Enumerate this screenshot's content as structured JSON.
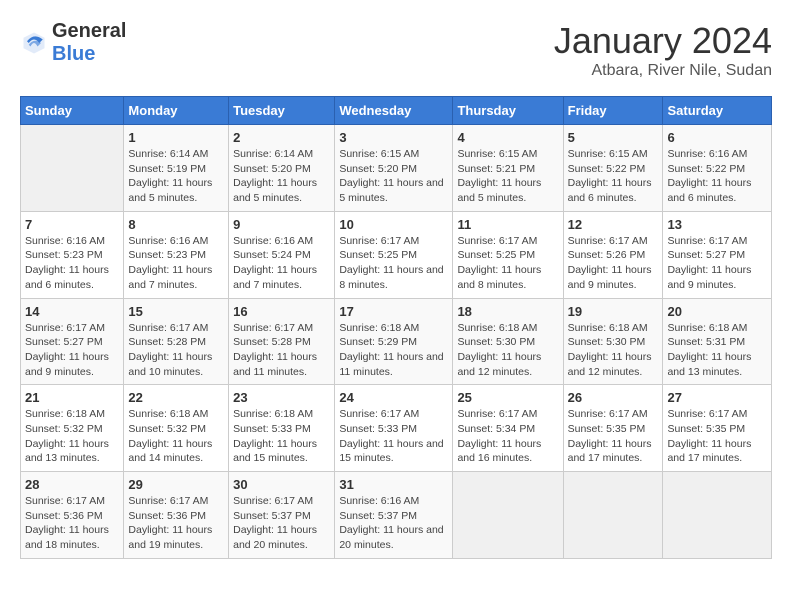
{
  "logo": {
    "text_general": "General",
    "text_blue": "Blue"
  },
  "title": "January 2024",
  "subtitle": "Atbara, River Nile, Sudan",
  "days_of_week": [
    "Sunday",
    "Monday",
    "Tuesday",
    "Wednesday",
    "Thursday",
    "Friday",
    "Saturday"
  ],
  "weeks": [
    [
      {
        "day": "",
        "sunrise": "",
        "sunset": "",
        "daylight": ""
      },
      {
        "day": "1",
        "sunrise": "Sunrise: 6:14 AM",
        "sunset": "Sunset: 5:19 PM",
        "daylight": "Daylight: 11 hours and 5 minutes."
      },
      {
        "day": "2",
        "sunrise": "Sunrise: 6:14 AM",
        "sunset": "Sunset: 5:20 PM",
        "daylight": "Daylight: 11 hours and 5 minutes."
      },
      {
        "day": "3",
        "sunrise": "Sunrise: 6:15 AM",
        "sunset": "Sunset: 5:20 PM",
        "daylight": "Daylight: 11 hours and 5 minutes."
      },
      {
        "day": "4",
        "sunrise": "Sunrise: 6:15 AM",
        "sunset": "Sunset: 5:21 PM",
        "daylight": "Daylight: 11 hours and 5 minutes."
      },
      {
        "day": "5",
        "sunrise": "Sunrise: 6:15 AM",
        "sunset": "Sunset: 5:22 PM",
        "daylight": "Daylight: 11 hours and 6 minutes."
      },
      {
        "day": "6",
        "sunrise": "Sunrise: 6:16 AM",
        "sunset": "Sunset: 5:22 PM",
        "daylight": "Daylight: 11 hours and 6 minutes."
      }
    ],
    [
      {
        "day": "7",
        "sunrise": "Sunrise: 6:16 AM",
        "sunset": "Sunset: 5:23 PM",
        "daylight": "Daylight: 11 hours and 6 minutes."
      },
      {
        "day": "8",
        "sunrise": "Sunrise: 6:16 AM",
        "sunset": "Sunset: 5:23 PM",
        "daylight": "Daylight: 11 hours and 7 minutes."
      },
      {
        "day": "9",
        "sunrise": "Sunrise: 6:16 AM",
        "sunset": "Sunset: 5:24 PM",
        "daylight": "Daylight: 11 hours and 7 minutes."
      },
      {
        "day": "10",
        "sunrise": "Sunrise: 6:17 AM",
        "sunset": "Sunset: 5:25 PM",
        "daylight": "Daylight: 11 hours and 8 minutes."
      },
      {
        "day": "11",
        "sunrise": "Sunrise: 6:17 AM",
        "sunset": "Sunset: 5:25 PM",
        "daylight": "Daylight: 11 hours and 8 minutes."
      },
      {
        "day": "12",
        "sunrise": "Sunrise: 6:17 AM",
        "sunset": "Sunset: 5:26 PM",
        "daylight": "Daylight: 11 hours and 9 minutes."
      },
      {
        "day": "13",
        "sunrise": "Sunrise: 6:17 AM",
        "sunset": "Sunset: 5:27 PM",
        "daylight": "Daylight: 11 hours and 9 minutes."
      }
    ],
    [
      {
        "day": "14",
        "sunrise": "Sunrise: 6:17 AM",
        "sunset": "Sunset: 5:27 PM",
        "daylight": "Daylight: 11 hours and 9 minutes."
      },
      {
        "day": "15",
        "sunrise": "Sunrise: 6:17 AM",
        "sunset": "Sunset: 5:28 PM",
        "daylight": "Daylight: 11 hours and 10 minutes."
      },
      {
        "day": "16",
        "sunrise": "Sunrise: 6:17 AM",
        "sunset": "Sunset: 5:28 PM",
        "daylight": "Daylight: 11 hours and 11 minutes."
      },
      {
        "day": "17",
        "sunrise": "Sunrise: 6:18 AM",
        "sunset": "Sunset: 5:29 PM",
        "daylight": "Daylight: 11 hours and 11 minutes."
      },
      {
        "day": "18",
        "sunrise": "Sunrise: 6:18 AM",
        "sunset": "Sunset: 5:30 PM",
        "daylight": "Daylight: 11 hours and 12 minutes."
      },
      {
        "day": "19",
        "sunrise": "Sunrise: 6:18 AM",
        "sunset": "Sunset: 5:30 PM",
        "daylight": "Daylight: 11 hours and 12 minutes."
      },
      {
        "day": "20",
        "sunrise": "Sunrise: 6:18 AM",
        "sunset": "Sunset: 5:31 PM",
        "daylight": "Daylight: 11 hours and 13 minutes."
      }
    ],
    [
      {
        "day": "21",
        "sunrise": "Sunrise: 6:18 AM",
        "sunset": "Sunset: 5:32 PM",
        "daylight": "Daylight: 11 hours and 13 minutes."
      },
      {
        "day": "22",
        "sunrise": "Sunrise: 6:18 AM",
        "sunset": "Sunset: 5:32 PM",
        "daylight": "Daylight: 11 hours and 14 minutes."
      },
      {
        "day": "23",
        "sunrise": "Sunrise: 6:18 AM",
        "sunset": "Sunset: 5:33 PM",
        "daylight": "Daylight: 11 hours and 15 minutes."
      },
      {
        "day": "24",
        "sunrise": "Sunrise: 6:17 AM",
        "sunset": "Sunset: 5:33 PM",
        "daylight": "Daylight: 11 hours and 15 minutes."
      },
      {
        "day": "25",
        "sunrise": "Sunrise: 6:17 AM",
        "sunset": "Sunset: 5:34 PM",
        "daylight": "Daylight: 11 hours and 16 minutes."
      },
      {
        "day": "26",
        "sunrise": "Sunrise: 6:17 AM",
        "sunset": "Sunset: 5:35 PM",
        "daylight": "Daylight: 11 hours and 17 minutes."
      },
      {
        "day": "27",
        "sunrise": "Sunrise: 6:17 AM",
        "sunset": "Sunset: 5:35 PM",
        "daylight": "Daylight: 11 hours and 17 minutes."
      }
    ],
    [
      {
        "day": "28",
        "sunrise": "Sunrise: 6:17 AM",
        "sunset": "Sunset: 5:36 PM",
        "daylight": "Daylight: 11 hours and 18 minutes."
      },
      {
        "day": "29",
        "sunrise": "Sunrise: 6:17 AM",
        "sunset": "Sunset: 5:36 PM",
        "daylight": "Daylight: 11 hours and 19 minutes."
      },
      {
        "day": "30",
        "sunrise": "Sunrise: 6:17 AM",
        "sunset": "Sunset: 5:37 PM",
        "daylight": "Daylight: 11 hours and 20 minutes."
      },
      {
        "day": "31",
        "sunrise": "Sunrise: 6:16 AM",
        "sunset": "Sunset: 5:37 PM",
        "daylight": "Daylight: 11 hours and 20 minutes."
      },
      {
        "day": "",
        "sunrise": "",
        "sunset": "",
        "daylight": ""
      },
      {
        "day": "",
        "sunrise": "",
        "sunset": "",
        "daylight": ""
      },
      {
        "day": "",
        "sunrise": "",
        "sunset": "",
        "daylight": ""
      }
    ]
  ]
}
